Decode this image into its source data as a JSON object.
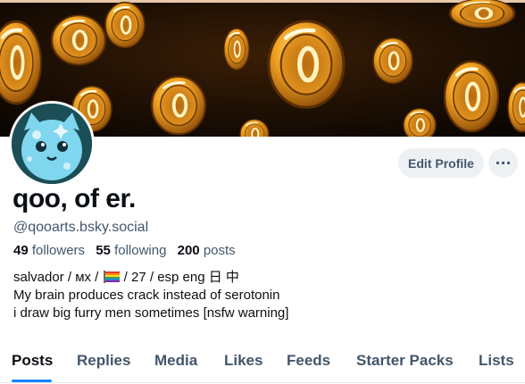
{
  "profile": {
    "display_name": "qoo, of er.",
    "handle": "@qooarts.bsky.social",
    "stats": {
      "followers_count": "49",
      "followers_label": "followers",
      "following_count": "55",
      "following_label": "following",
      "posts_count": "200",
      "posts_label": "posts"
    },
    "bio": {
      "line1_before_flag": "salvador / ᴍx / ",
      "line1_after_flag": " / 27 / esp eng 日 中",
      "line2": "My brain produces crack instead of serotonin",
      "line3": "i draw big furry men sometimes [nsfw warning]"
    },
    "flag_icon": "rainbow-flag-icon"
  },
  "actions": {
    "edit_profile": "Edit Profile",
    "more": "···"
  },
  "tabs": [
    {
      "label": "Posts",
      "active": true
    },
    {
      "label": "Replies"
    },
    {
      "label": "Media"
    },
    {
      "label": "Likes"
    },
    {
      "label": "Feeds"
    },
    {
      "label": "Starter Packs"
    },
    {
      "label": "Lists"
    }
  ],
  "colors": {
    "accent": "#1083fe",
    "text_primary": "#0b0f14",
    "text_secondary": "#42576c",
    "button_bg": "#eef1f4",
    "banner_gold": "#f0a828"
  },
  "banner": {
    "icon": "gold-coins-banner"
  },
  "avatar": {
    "icon": "blue-cat-avatar"
  }
}
